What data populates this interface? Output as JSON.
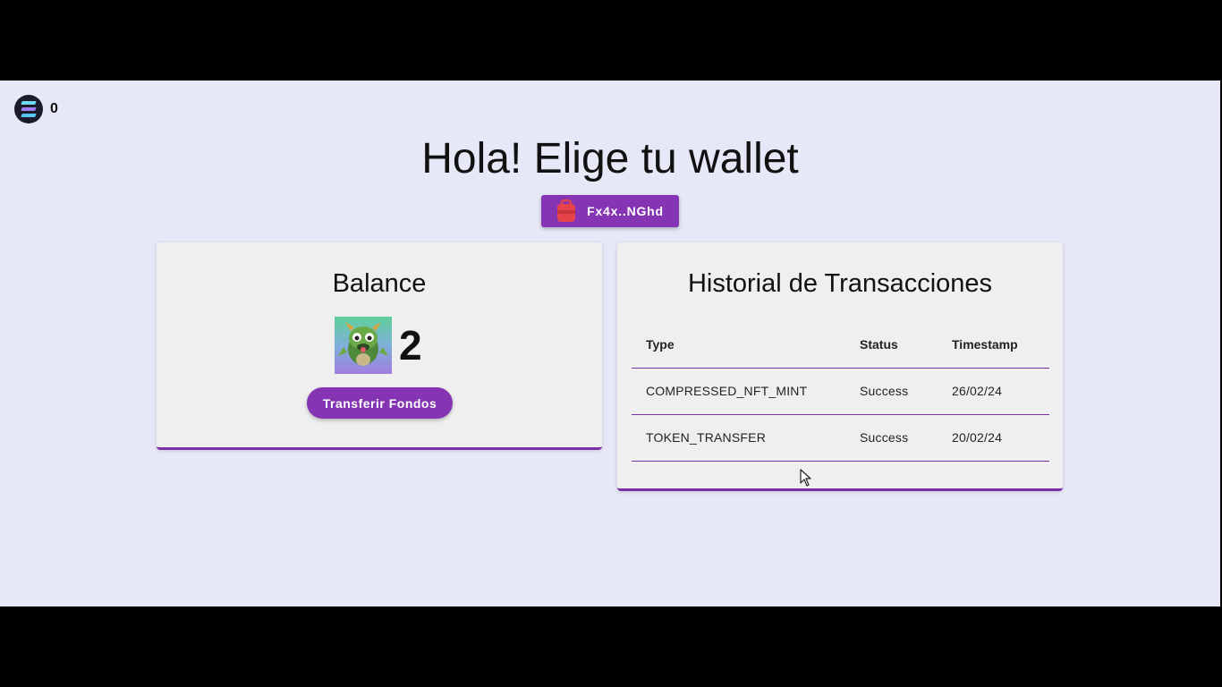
{
  "header": {
    "sol_balance": "0",
    "title": "Hola! Elige tu wallet"
  },
  "wallet": {
    "label": "Fx4x..NGhd",
    "icon": "backpack-icon",
    "color": "#8534b3"
  },
  "balance_card": {
    "title": "Balance",
    "nft_icon": "dragon-nft-image",
    "count": "2",
    "transfer_label": "Transferir Fondos"
  },
  "history_card": {
    "title": "Historial de Transacciones",
    "columns": [
      "Type",
      "Status",
      "Timestamp"
    ],
    "rows": [
      {
        "type": "COMPRESSED_NFT_MINT",
        "status": "Success",
        "timestamp": "26/02/24"
      },
      {
        "type": "TOKEN_TRANSFER",
        "status": "Success",
        "timestamp": "20/02/24"
      }
    ]
  },
  "colors": {
    "accent": "#8534b3",
    "background": "#e6e7f7",
    "card": "#efefef"
  }
}
